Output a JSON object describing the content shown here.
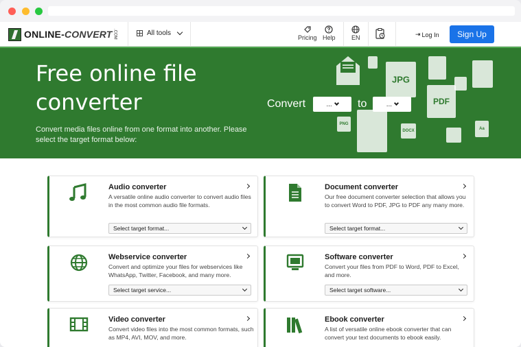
{
  "brand": {
    "logo_text_1": "ONLINE-",
    "logo_text_2": "CONVERT",
    "logo_suffix": ".COM",
    "primary_color": "#2f7a2f",
    "button_color": "#1a73e8"
  },
  "nav": {
    "all_tools": "All tools",
    "pricing": "Pricing",
    "help": "Help",
    "language": "EN",
    "login": "Log In",
    "signup": "Sign Up"
  },
  "hero": {
    "title": "Free online file converter",
    "subtitle": "Convert media files online from one format into another. Please select the target format below:",
    "convert_label": "Convert",
    "to_label": "to",
    "from_select": "...",
    "to_select": "...",
    "file_labels": [
      "JPG",
      "PDF",
      "PNG",
      "DOCX",
      "Aa"
    ]
  },
  "cards": [
    {
      "title": "Audio converter",
      "desc": "A versatile online audio converter to convert audio files in the most common audio file formats.",
      "select": "Select target format...",
      "icon": "music-note-icon"
    },
    {
      "title": "Document converter",
      "desc": "Our free document converter selection that allows you to convert Word to PDF, JPG to PDF any many more.",
      "select": "Select target format...",
      "icon": "document-icon"
    },
    {
      "title": "Webservice converter",
      "desc": "Convert and optimize your files for webservices like WhatsApp, Twitter, Facebook, and many more.",
      "select": "Select target service...",
      "icon": "globe-icon"
    },
    {
      "title": "Software converter",
      "desc": "Convert your files from PDF to Word, PDF to Excel, and more.",
      "select": "Select target software...",
      "icon": "monitor-icon"
    },
    {
      "title": "Video converter",
      "desc": "Convert video files into the most common formats, such as MP4, AVI, MOV, and more.",
      "select": "",
      "icon": "film-icon"
    },
    {
      "title": "Ebook converter",
      "desc": "A list of versatile online ebook converter that can convert your text documents to ebook easily.",
      "select": "",
      "icon": "books-icon"
    }
  ]
}
